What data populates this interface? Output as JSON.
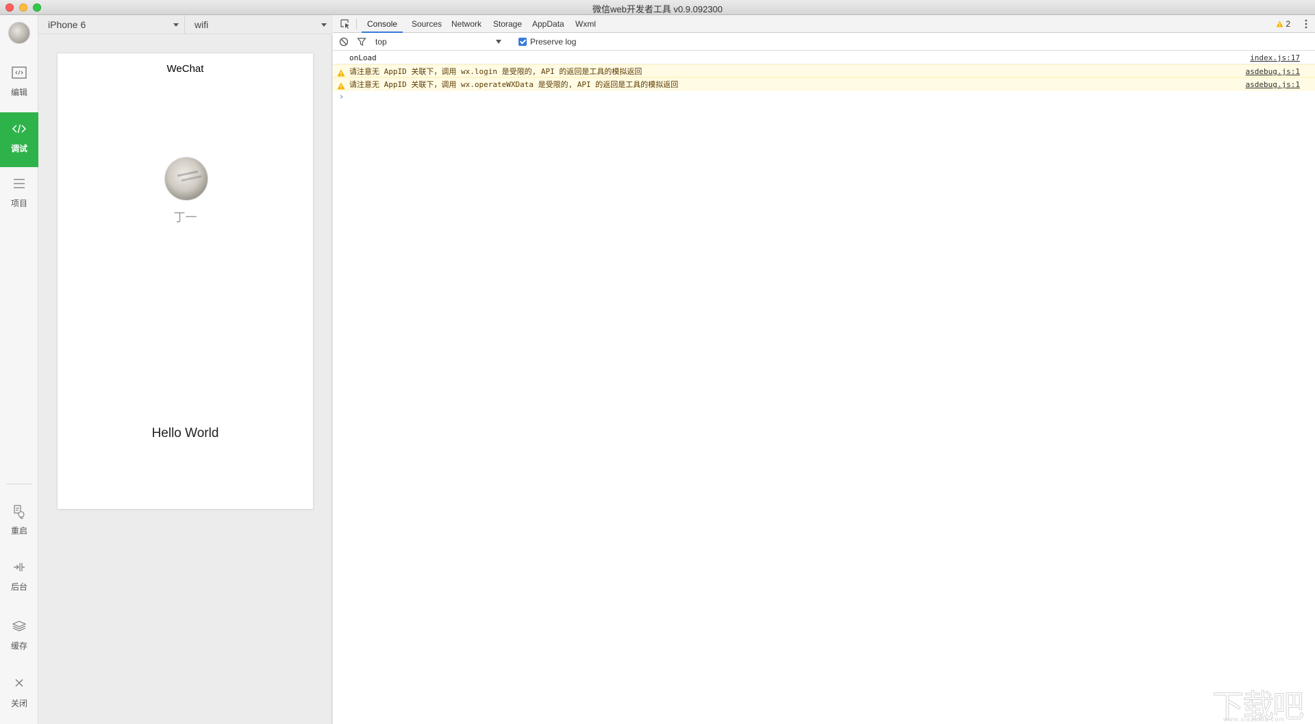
{
  "window": {
    "title": "微信web开发者工具 v0.9.092300"
  },
  "sidebar": {
    "items": [
      {
        "label": "编辑",
        "icon": "code-box-icon"
      },
      {
        "label": "调试",
        "icon": "code-brackets-icon",
        "active": true
      },
      {
        "label": "项目",
        "icon": "list-icon"
      },
      {
        "label": "重启",
        "icon": "restart-icon"
      },
      {
        "label": "后台",
        "icon": "background-icon"
      },
      {
        "label": "缓存",
        "icon": "layers-icon"
      },
      {
        "label": "关闭",
        "icon": "close-icon"
      }
    ]
  },
  "device_bar": {
    "device": "iPhone 6",
    "network": "wifi"
  },
  "simulator": {
    "nav_title": "WeChat",
    "nickname": "丁一",
    "hello_text": "Hello World"
  },
  "devtools": {
    "tabs": [
      "Console",
      "Sources",
      "Network",
      "Storage",
      "AppData",
      "Wxml"
    ],
    "active_tab": "Console",
    "warning_count": "2",
    "filter": {
      "context": "top",
      "preserve_log_label": "Preserve log",
      "preserve_log_checked": true
    },
    "console_rows": [
      {
        "level": "log",
        "message": "onLoad",
        "source": "index.js:17"
      },
      {
        "level": "warning",
        "message": "请注意无 AppID 关联下，调用 wx.login 是受限的, API 的返回是工具的模拟返回",
        "source": "asdebug.js:1"
      },
      {
        "level": "warning",
        "message": "请注意无 AppID 关联下，调用 wx.operateWXData 是受限的, API 的返回是工具的模拟返回",
        "source": "asdebug.js:1"
      }
    ],
    "prompt_symbol": "›"
  },
  "watermark": {
    "text": "下载吧",
    "sub": "www.xiazaiba.com"
  },
  "colors": {
    "accent_green": "#2eb34b",
    "devtools_blue": "#3879d9",
    "warn_bg": "#fffbe5"
  }
}
